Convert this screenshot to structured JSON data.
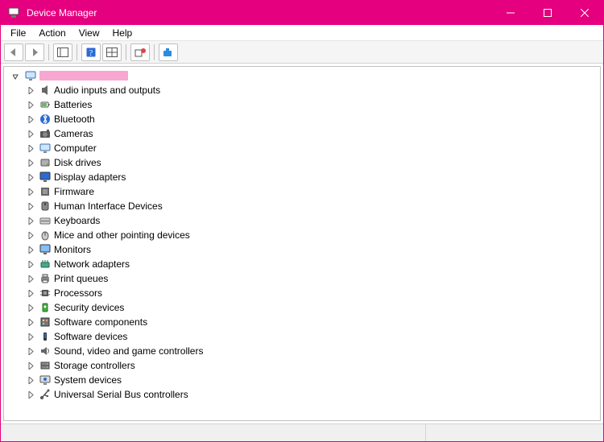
{
  "window": {
    "title": "Device Manager"
  },
  "menu": {
    "file": "File",
    "action": "Action",
    "view": "View",
    "help": "Help"
  },
  "root": {
    "name": "(Computer name redacted)"
  },
  "categories": [
    {
      "icon": "audio",
      "label": "Audio inputs and outputs"
    },
    {
      "icon": "battery",
      "label": "Batteries"
    },
    {
      "icon": "bluetooth",
      "label": "Bluetooth"
    },
    {
      "icon": "camera",
      "label": "Cameras"
    },
    {
      "icon": "computer",
      "label": "Computer"
    },
    {
      "icon": "disk",
      "label": "Disk drives"
    },
    {
      "icon": "display",
      "label": "Display adapters"
    },
    {
      "icon": "firmware",
      "label": "Firmware"
    },
    {
      "icon": "hid",
      "label": "Human Interface Devices"
    },
    {
      "icon": "keyboard",
      "label": "Keyboards"
    },
    {
      "icon": "mouse",
      "label": "Mice and other pointing devices"
    },
    {
      "icon": "monitor",
      "label": "Monitors"
    },
    {
      "icon": "network",
      "label": "Network adapters"
    },
    {
      "icon": "printer",
      "label": "Print queues"
    },
    {
      "icon": "cpu",
      "label": "Processors"
    },
    {
      "icon": "security",
      "label": "Security devices"
    },
    {
      "icon": "swcomp",
      "label": "Software components"
    },
    {
      "icon": "swdev",
      "label": "Software devices"
    },
    {
      "icon": "sound",
      "label": "Sound, video and game controllers"
    },
    {
      "icon": "storage",
      "label": "Storage controllers"
    },
    {
      "icon": "system",
      "label": "System devices"
    },
    {
      "icon": "usb",
      "label": "Universal Serial Bus controllers"
    }
  ]
}
